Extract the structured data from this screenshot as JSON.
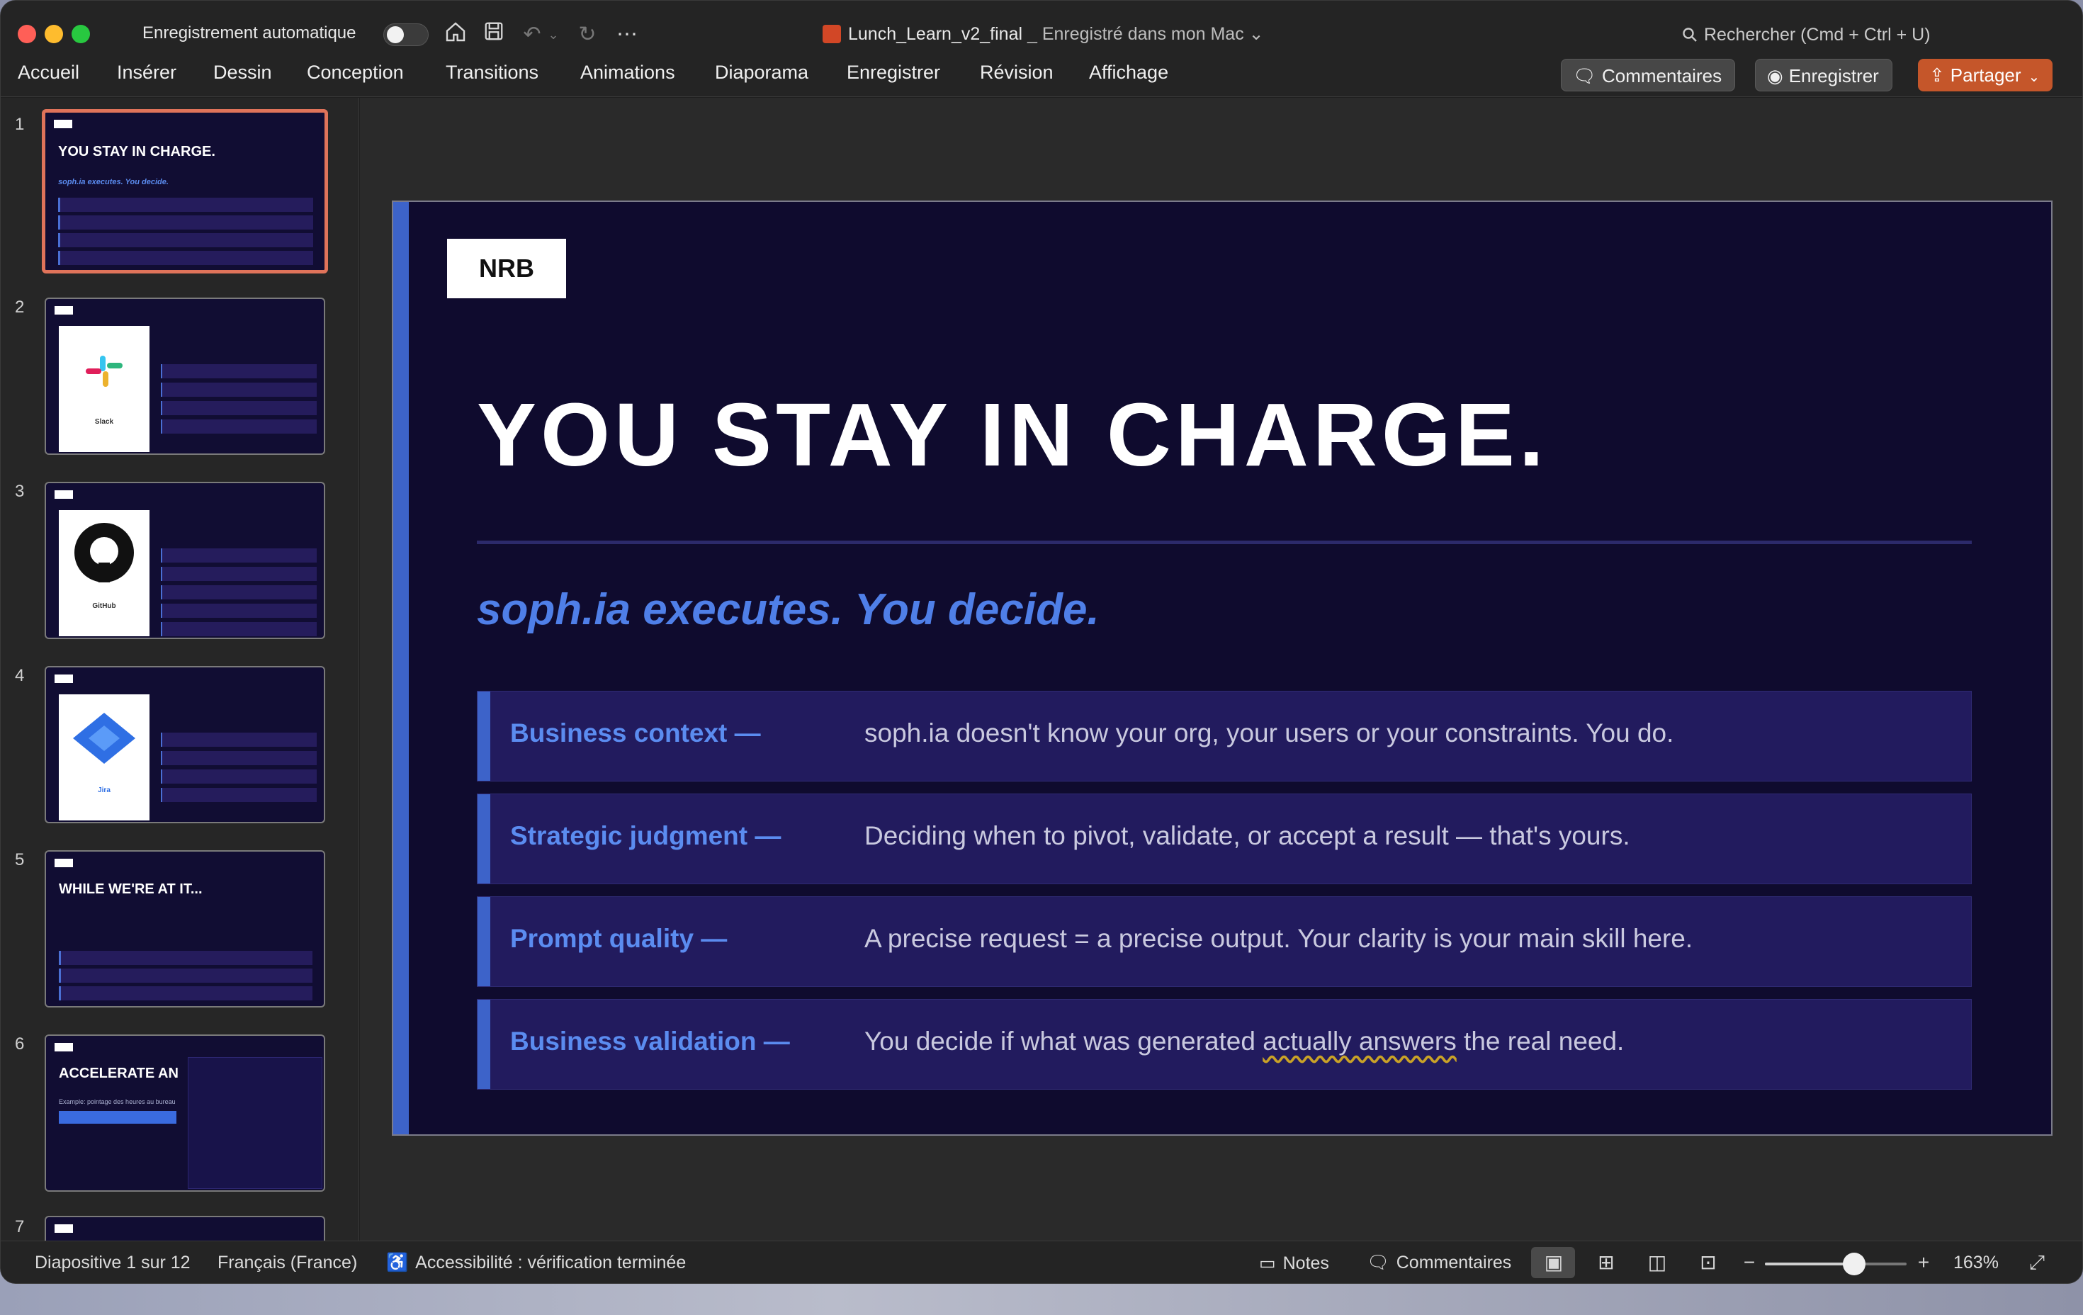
{
  "titlebar": {
    "autosave_label": "Enregistrement automatique",
    "autosave_on": false,
    "doc_name": "Lunch_Learn_v2_final",
    "doc_status": " _ Enregistré dans mon Mac",
    "search_placeholder": "Rechercher (Cmd + Ctrl + U)"
  },
  "ribbon": {
    "tabs": [
      "Accueil",
      "Insérer",
      "Dessin",
      "Conception",
      "Transitions",
      "Animations",
      "Diaporama",
      "Enregistrer",
      "Révision",
      "Affichage"
    ],
    "comments_btn": "Commentaires",
    "record_btn": "Enregistrer",
    "share_btn": "Partager"
  },
  "sidebar": {
    "slides": [
      {
        "num": "1",
        "title": "YOU STAY IN CHARGE.",
        "sub": "soph.ia executes. You decide."
      },
      {
        "num": "2",
        "box_label": "Slack"
      },
      {
        "num": "3",
        "box_label": "GitHub"
      },
      {
        "num": "4",
        "box_label": "Jira"
      },
      {
        "num": "5",
        "title": "WHILE WE'RE AT IT..."
      },
      {
        "num": "6",
        "title": "ACCELERATE AN",
        "sub": "Example: pointage des heures au bureau"
      },
      {
        "num": "7"
      }
    ]
  },
  "slide": {
    "logo": "NRB",
    "title": "YOU STAY IN CHARGE.",
    "subtitle": "soph.ia executes. You decide.",
    "rows": [
      {
        "key": "Business context —",
        "value": "soph.ia doesn't know your org, your users or your constraints. You do."
      },
      {
        "key": "Strategic judgment —",
        "value": "Deciding when to pivot, validate, or accept a result — that's yours."
      },
      {
        "key": "Prompt quality —",
        "value": "A precise request = a precise output. Your clarity is your main skill here."
      },
      {
        "key": "Business validation —",
        "value_pre": "You decide if what was generated ",
        "value_mark": "actually answers",
        "value_post": " the real need."
      }
    ]
  },
  "status": {
    "slide_pos": "Diapositive 1 sur 12",
    "language": "Français (France)",
    "accessibility": "Accessibilité : vérification terminée",
    "notes": "Notes",
    "comments": "Commentaires",
    "zoom": "163%",
    "zoom_fraction": 0.63
  },
  "colors": {
    "accent": "#3d63c9",
    "share": "#c5562a",
    "slide_bg": "#0f0b2e"
  }
}
